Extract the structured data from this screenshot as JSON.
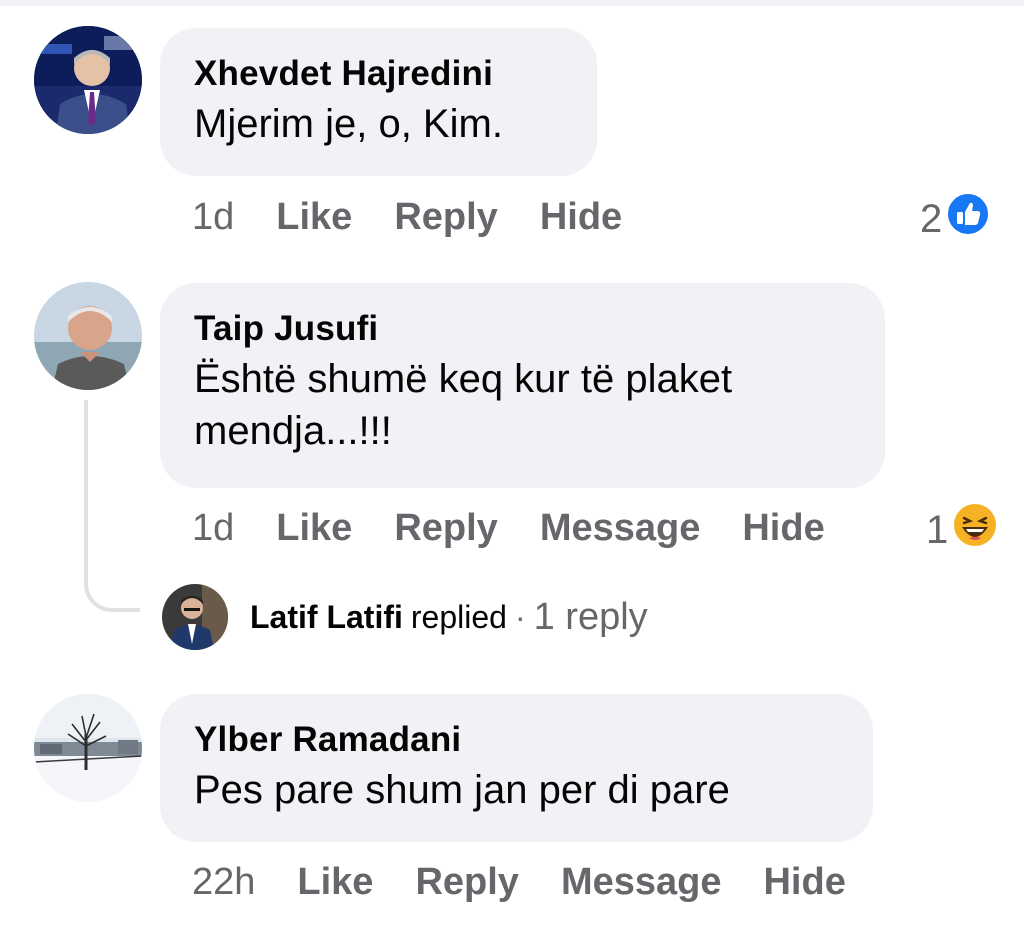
{
  "comments": [
    {
      "author": "Xhevdet Hajredini",
      "text": "Mjerim je, o, Kim.",
      "time": "1d",
      "actions": [
        "Like",
        "Reply",
        "Hide"
      ],
      "reaction_count": "2",
      "reaction_icon": "like-reaction-icon"
    },
    {
      "author": "Taip Jusufi",
      "text_line1": "Është shumë keq kur të plaket",
      "text_line2": "mendja...!!!",
      "time": "1d",
      "actions": [
        "Like",
        "Reply",
        "Message",
        "Hide"
      ],
      "reaction_count": "1",
      "reaction_icon": "haha-reaction-icon",
      "replies": {
        "replier": "Latif Latifi",
        "replied_word": "replied",
        "separator": "·",
        "count_label": "1 reply"
      }
    },
    {
      "author": "Ylber Ramadani",
      "text": "Pes pare shum jan per di pare",
      "time": "22h",
      "actions": [
        "Like",
        "Reply",
        "Message",
        "Hide"
      ]
    }
  ],
  "colors": {
    "bubble_bg": "#f0f2f5",
    "meta_text": "#65676b",
    "like_blue": "#1877f2",
    "haha_yellow": "#f7b125"
  }
}
